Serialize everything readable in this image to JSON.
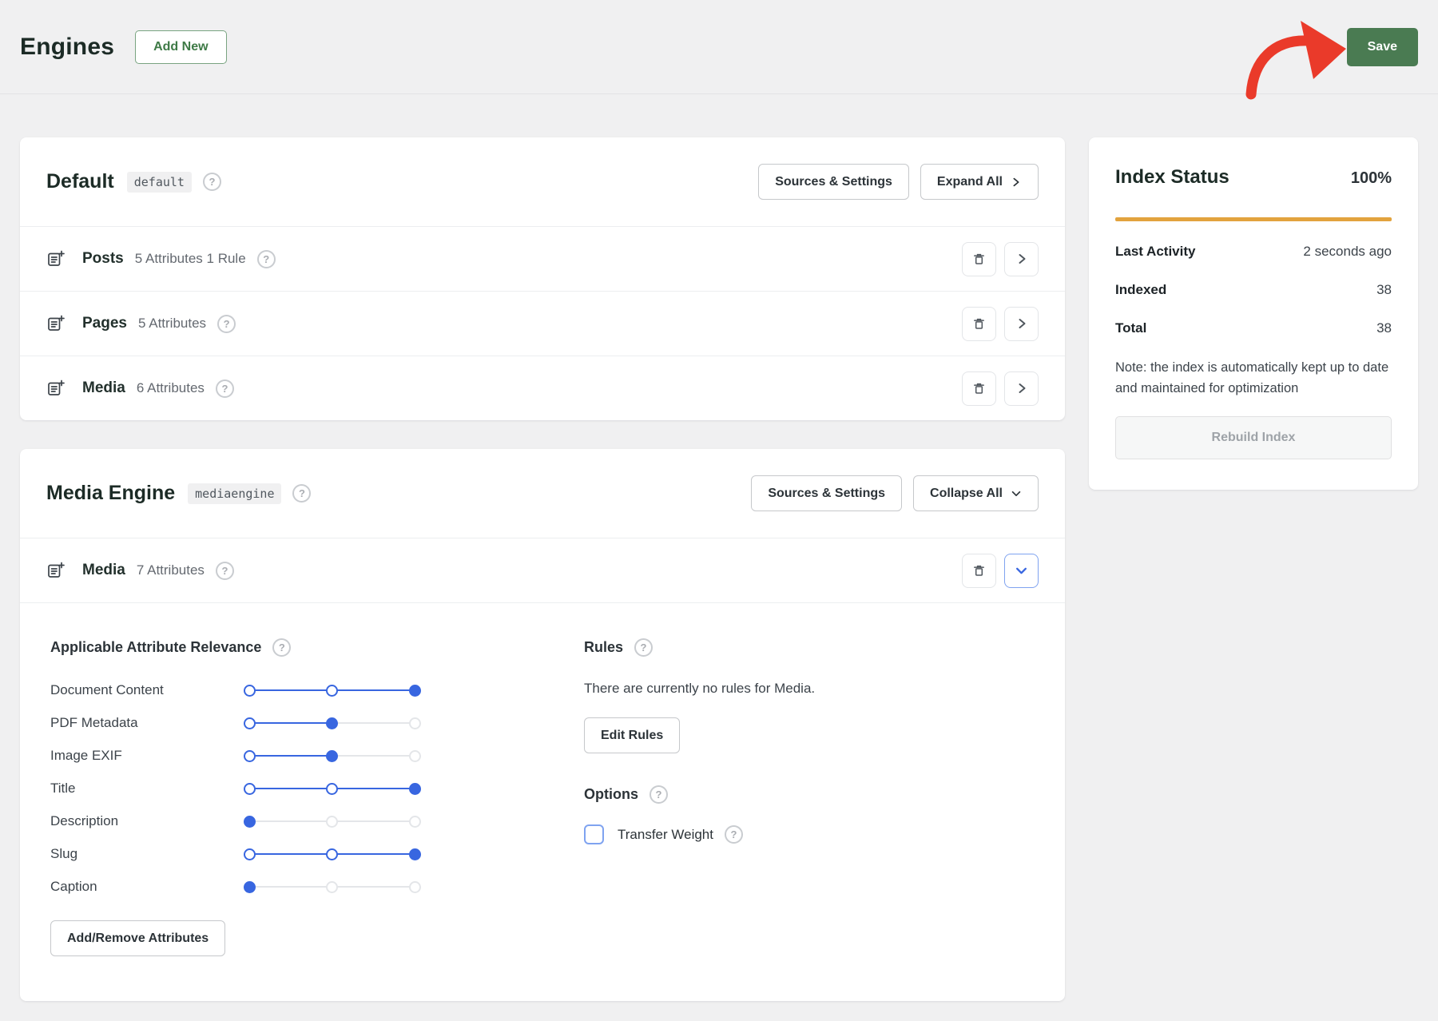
{
  "header": {
    "title": "Engines",
    "add_new_label": "Add New",
    "save_label": "Save"
  },
  "engines": [
    {
      "name": "Default",
      "slug": "default",
      "sources_settings_label": "Sources & Settings",
      "toggle_label": "Expand All",
      "sources": [
        {
          "name": "Posts",
          "meta": "5 Attributes 1 Rule"
        },
        {
          "name": "Pages",
          "meta": "5 Attributes"
        },
        {
          "name": "Media",
          "meta": "6 Attributes"
        }
      ]
    },
    {
      "name": "Media Engine",
      "slug": "mediaengine",
      "sources_settings_label": "Sources & Settings",
      "toggle_label": "Collapse All",
      "sources": [
        {
          "name": "Media",
          "meta": "7 Attributes",
          "expanded": true
        }
      ],
      "detail": {
        "relevance_title": "Applicable Attribute Relevance",
        "attributes": [
          {
            "label": "Document Content",
            "value": 100
          },
          {
            "label": "PDF Metadata",
            "value": 50
          },
          {
            "label": "Image EXIF",
            "value": 50
          },
          {
            "label": "Title",
            "value": 100
          },
          {
            "label": "Description",
            "value": 0
          },
          {
            "label": "Slug",
            "value": 100
          },
          {
            "label": "Caption",
            "value": 0
          }
        ],
        "add_remove_label": "Add/Remove Attributes",
        "rules_title": "Rules",
        "rules_empty_text": "There are currently no rules for Media.",
        "edit_rules_label": "Edit Rules",
        "options_title": "Options",
        "transfer_weight_label": "Transfer Weight",
        "transfer_weight_checked": false
      }
    }
  ],
  "index_status": {
    "title": "Index Status",
    "percent": "100%",
    "rows": [
      {
        "label": "Last Activity",
        "value": "2 seconds ago"
      },
      {
        "label": "Indexed",
        "value": "38"
      },
      {
        "label": "Total",
        "value": "38"
      }
    ],
    "note": "Note: the index is automatically kept up to date and maintained for optimization",
    "rebuild_label": "Rebuild Index"
  },
  "icons": {
    "source-icon": "document-plus",
    "delete-icon": "trash",
    "expand-icon": "chevron-right",
    "collapse-icon": "chevron-down",
    "help-icon": "question-circle",
    "annotation": "red-hand-drawn-arrow"
  },
  "colors": {
    "accent_green": "#4a7b52",
    "accent_blue": "#3866e0",
    "progress_orange": "#e2a33e",
    "annotation_red": "#ea3a2a",
    "page_background": "#f0f0f1"
  }
}
